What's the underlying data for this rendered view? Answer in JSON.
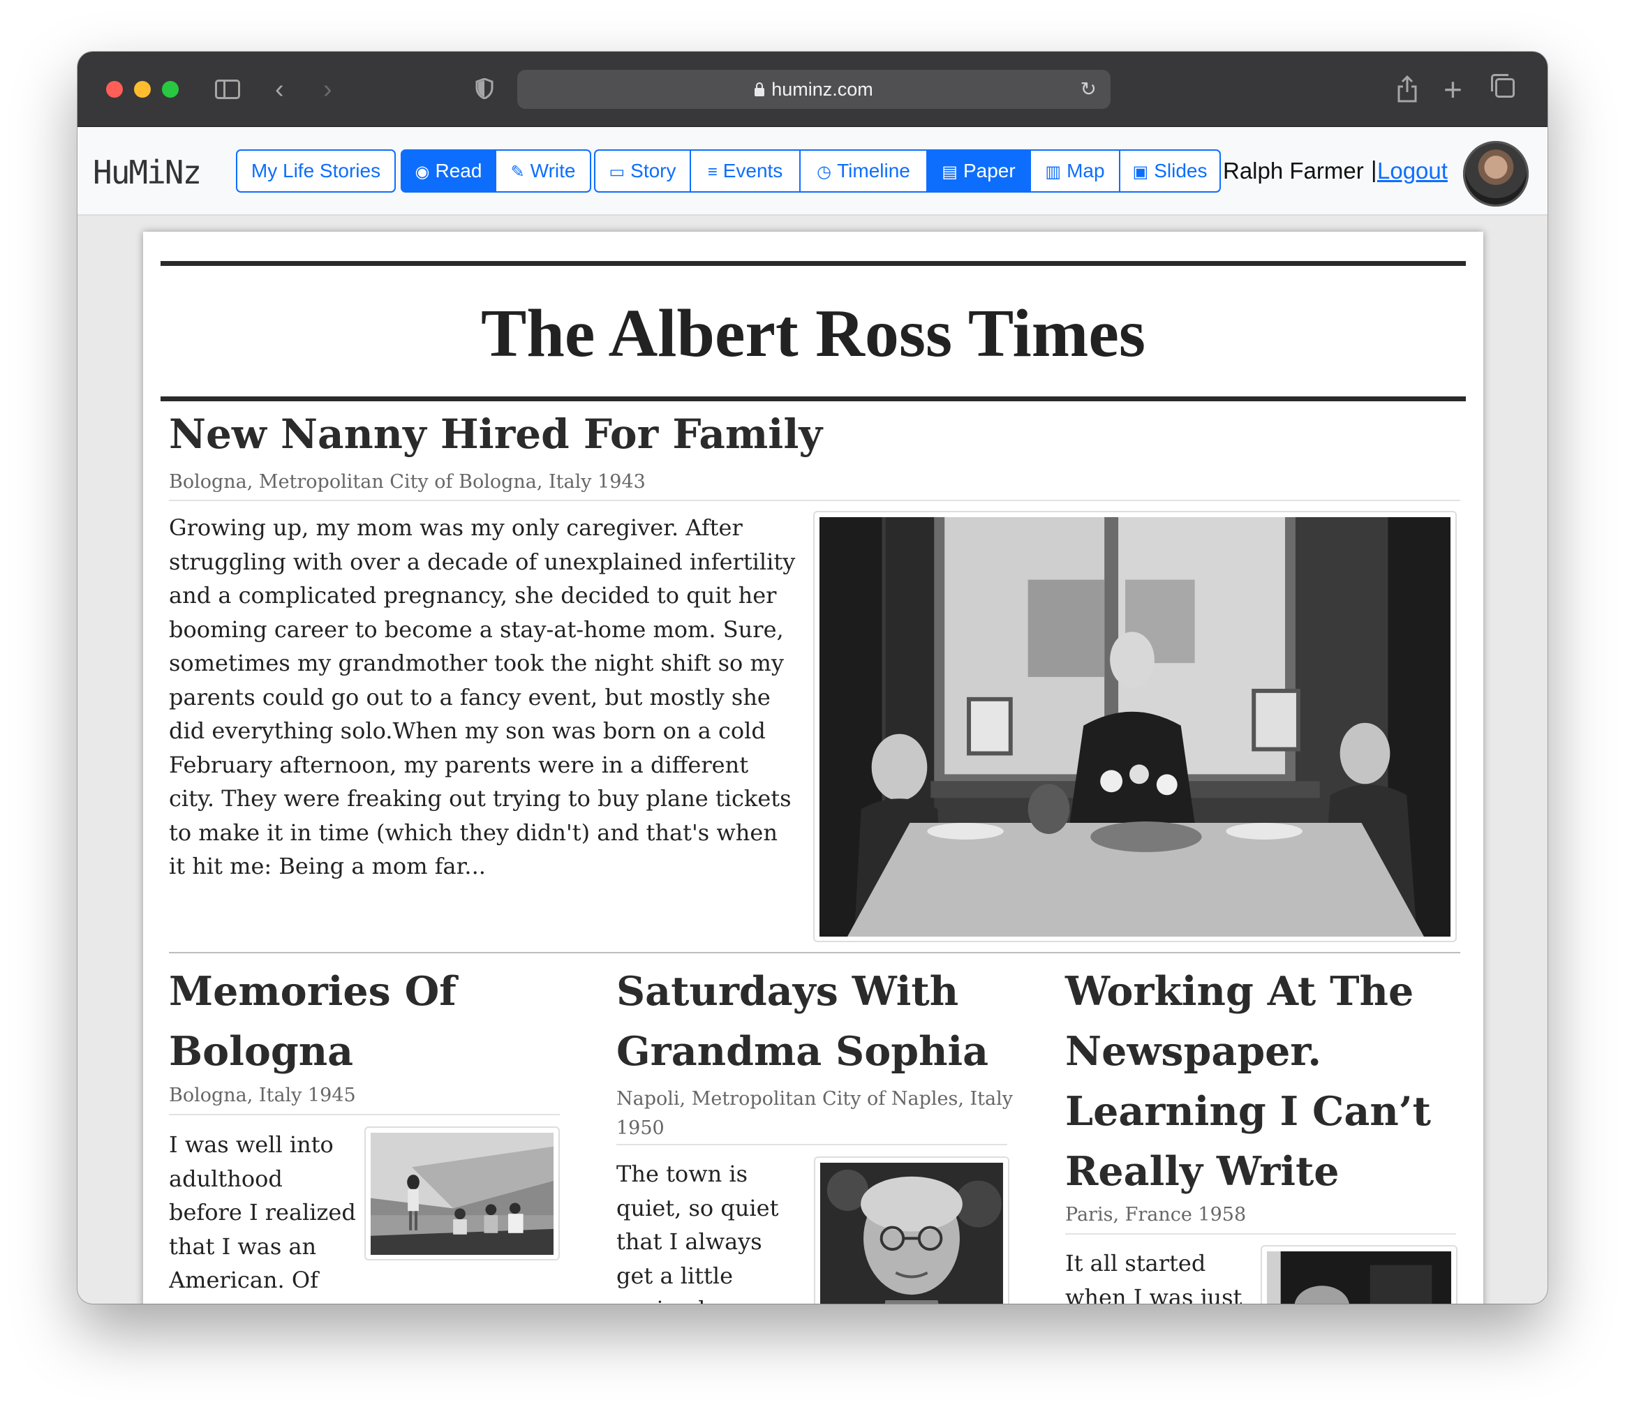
{
  "browser": {
    "url": "huminz.com"
  },
  "nav": {
    "brand": "HuMiNz",
    "buttons": {
      "my_life_stories": "My Life Stories",
      "read": "Read",
      "write": "Write",
      "story": "Story",
      "events": "Events",
      "timeline": "Timeline",
      "paper": "Paper",
      "map": "Map",
      "slides": "Slides"
    },
    "user_name": "Ralph Farmer",
    "separator": "|",
    "logout": "Logout"
  },
  "paper": {
    "title": "The Albert Ross Times",
    "lead": {
      "headline": "New Nanny Hired For Family",
      "dateline": "Bologna, Metropolitan City of Bologna, Italy 1943",
      "body": "Growing up, my mom was my only caregiver. After struggling with over a decade of unexplained infertility and a complicated pregnancy, she decided to quit her booming career to become a stay-at-home mom. Sure, sometimes my grandmother took the night shift so my parents could go out to a fancy event, but mostly she did everything solo.When my son was born on a cold February afternoon, my parents were in a different city. They were freaking out trying to buy plane tickets to make it in time (which they didn't) and that's when it hit me: Being a mom far..."
    },
    "articles": [
      {
        "headline": "Memories Of Bologna",
        "dateline": "Bologna, Italy 1945",
        "body": "I was well into adulthood before I realized that I was an American. Of course, I had been born in Italy and had lived there all"
      },
      {
        "headline": "Saturdays With Grandma Sophia",
        "dateline": "Napoli, Metropolitan City of Naples, Italy 1950",
        "body": "The town is quiet, so quiet that I always get a little squirrely towards the end"
      },
      {
        "headline": "Working At The Newspaper. Learning I Can’t Really Write",
        "dateline": "Paris, France 1958",
        "body": "It all started when I was just"
      }
    ]
  },
  "colors": {
    "accent": "#0d6efd",
    "chrome": "#38383a",
    "paper_rule": "#2a2a2a"
  }
}
